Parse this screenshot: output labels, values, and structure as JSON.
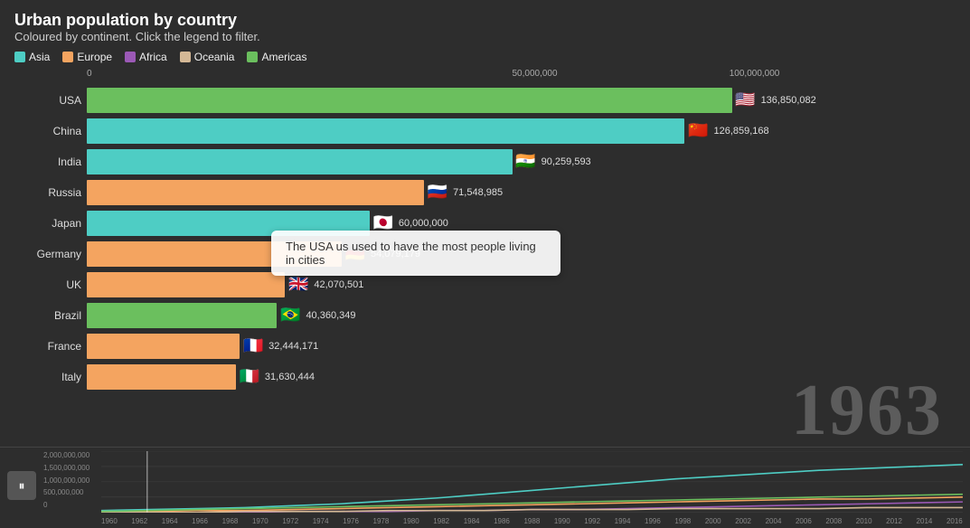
{
  "title": "Urban population by country",
  "subtitle": "Coloured by continent. Click the legend to filter.",
  "legend": [
    {
      "label": "Asia",
      "color": "#4ecdc4"
    },
    {
      "label": "Europe",
      "color": "#f4a460"
    },
    {
      "label": "Africa",
      "color": "#9b59b6"
    },
    {
      "label": "Oceania",
      "color": "#d4b896"
    },
    {
      "label": "Americas",
      "color": "#6bbf5e"
    }
  ],
  "axis": {
    "labels": [
      "0",
      "50,000,000",
      "100,000,000"
    ],
    "positions": [
      0,
      0.5,
      1.0
    ]
  },
  "bars": [
    {
      "country": "USA",
      "value": 136850082,
      "valueLabel": "136,850,082",
      "color": "#6bbf5e",
      "flag": "🇺🇸",
      "width": 0.972
    },
    {
      "country": "China",
      "value": 126859168,
      "valueLabel": "126,859,168",
      "color": "#4ecdc4",
      "flag": "🇨🇳",
      "width": 0.902
    },
    {
      "country": "India",
      "value": 90259593,
      "valueLabel": "90,259,593",
      "color": "#4ecdc4",
      "flag": "🇮🇳",
      "width": 0.642
    },
    {
      "country": "Russia",
      "value": 71548985,
      "valueLabel": "71,548,985",
      "color": "#f4a460",
      "flag": "🇷🇺",
      "width": 0.509
    },
    {
      "country": "Japan",
      "value": 60000000,
      "valueLabel": "60,000,000",
      "color": "#4ecdc4",
      "flag": "🇯🇵",
      "width": 0.427
    },
    {
      "country": "Germany",
      "value": 54079179,
      "valueLabel": "54,079,179",
      "color": "#f4a460",
      "flag": "🇩🇪",
      "width": 0.385
    },
    {
      "country": "UK",
      "value": 42070501,
      "valueLabel": "42,070,501",
      "color": "#f4a460",
      "flag": "🇬🇧",
      "width": 0.299
    },
    {
      "country": "Brazil",
      "value": 40360349,
      "valueLabel": "40,360,349",
      "color": "#6bbf5e",
      "flag": "🇧🇷",
      "width": 0.287
    },
    {
      "country": "France",
      "value": 32444171,
      "valueLabel": "32,444,171",
      "color": "#f4a460",
      "flag": "🇫🇷",
      "width": 0.231
    },
    {
      "country": "Italy",
      "value": 31630444,
      "valueLabel": "31,630,444",
      "color": "#f4a460",
      "flag": "🇮🇹",
      "width": 0.225
    }
  ],
  "tooltip": {
    "text": "The USA us used to have the most people living in cities",
    "visible": true
  },
  "year": "1963",
  "timeline": {
    "yLabels": [
      "2,000,000,000",
      "1,500,000,000",
      "1,000,000,000",
      "500,000,000",
      "0"
    ],
    "xLabels": [
      "1960",
      "1962",
      "1964",
      "1966",
      "1968",
      "1970",
      "1972",
      "1974",
      "1976",
      "1978",
      "1980",
      "1982",
      "1984",
      "1986",
      "1988",
      "1990",
      "1992",
      "1994",
      "1996",
      "1998",
      "2000",
      "2002",
      "2004",
      "2006",
      "2008",
      "2010",
      "2012",
      "2014",
      "2016"
    ],
    "playLabel": "⏸"
  },
  "colors": {
    "background": "#2d2d2d",
    "barBackground": "#3a3a3a"
  }
}
